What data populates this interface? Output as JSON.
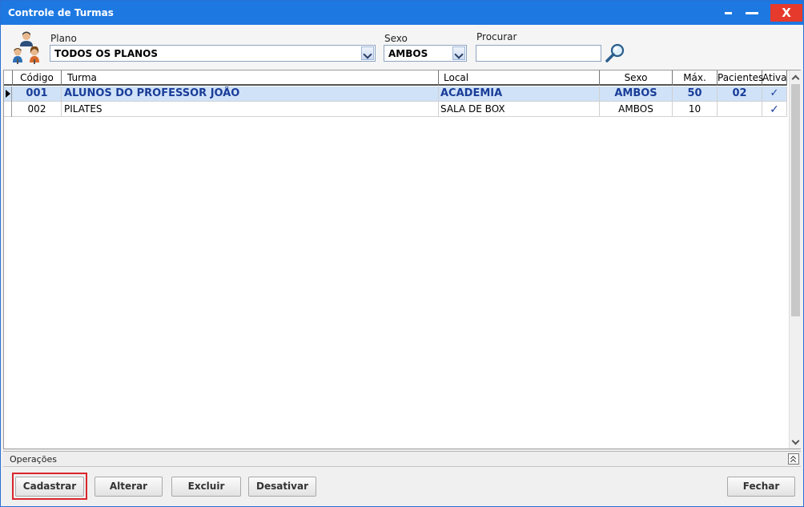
{
  "window": {
    "title": "Controle de Turmas",
    "close_label": "X"
  },
  "filters": {
    "plano_label": "Plano",
    "plano_value": "TODOS OS PLANOS",
    "sexo_label": "Sexo",
    "sexo_value": "AMBOS",
    "procurar_label": "Procurar",
    "procurar_value": ""
  },
  "grid": {
    "columns": [
      "Código",
      "Turma",
      "Local",
      "Sexo",
      "Máx.",
      "Pacientes",
      "Ativa"
    ],
    "rows": [
      {
        "codigo": "001",
        "turma": "ALUNOS DO PROFESSOR JOÃO",
        "local": "ACADEMIA",
        "sexo": "AMBOS",
        "max": "50",
        "pacientes": "02",
        "ativa": "✓",
        "selected": true
      },
      {
        "codigo": "002",
        "turma": "PILATES",
        "local": "SALA DE BOX",
        "sexo": "AMBOS",
        "max": "10",
        "pacientes": "",
        "ativa": "✓",
        "selected": false
      }
    ]
  },
  "operations": {
    "label": "Operações"
  },
  "buttons": {
    "cadastrar": "Cadastrar",
    "alterar": "Alterar",
    "excluir": "Excluir",
    "desativar": "Desativar",
    "fechar": "Fechar"
  },
  "icons": {
    "people": "people-group-icon",
    "search": "magnifier-icon"
  },
  "colors": {
    "titlebar": "#1d78e2",
    "close": "#e53a2c",
    "selected_row": "#cfe2f8",
    "selected_text": "#1a3d99",
    "highlight_frame": "#d9262c"
  }
}
